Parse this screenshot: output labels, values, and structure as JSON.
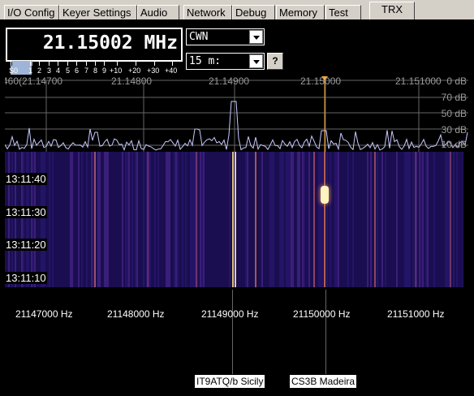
{
  "tabs": [
    "I/O Config",
    "Keyer Settings",
    "Audio",
    "Network",
    "Debug",
    "Memory",
    "Test",
    "TRX"
  ],
  "active_tab": "TRX",
  "frequency": "21.15002 MHz",
  "smeter": {
    "labels": [
      "S0",
      "1",
      "2",
      "3",
      "4",
      "5",
      "6",
      "7",
      "8",
      "9",
      "+10",
      "+20",
      "+30",
      "+40"
    ],
    "level_fraction": 0.12
  },
  "mode": {
    "value": "CWN"
  },
  "band": {
    "value": "15 m:"
  },
  "help_button": "?",
  "spectrum": {
    "freq_labels": [
      "460(21.14700",
      "21.14800",
      "21.14900",
      "21.15000",
      "21.151000"
    ],
    "db_labels": [
      "0 dB",
      "70 dB",
      "50 dB",
      "30 dB",
      "10 dB"
    ]
  },
  "waterfall": {
    "time_labels": [
      "13:11:40",
      "13:11:30",
      "13:11:20",
      "13:11:10"
    ]
  },
  "bottom_axis": {
    "labels": [
      "21147000 Hz",
      "21148000 Hz",
      "21149000 Hz",
      "21150000 Hz",
      "21151000 Hz"
    ]
  },
  "spots": [
    "IT9ATQ/b Sicily",
    "CS3B Madeira"
  ],
  "colors": {
    "accent_marker": "#ffa640",
    "waterfall_bg": "#160c48",
    "smeter_fill": "#9fb5d7"
  }
}
